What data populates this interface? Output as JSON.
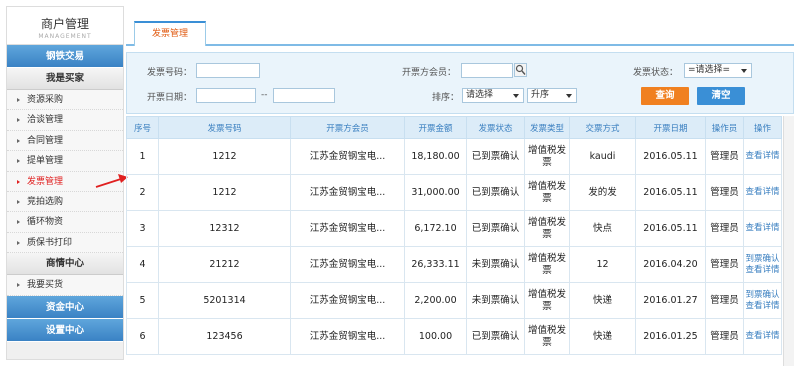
{
  "brand": {
    "title": "商户管理",
    "subtitle": "MANAGEMENT"
  },
  "sidebar": {
    "sections": [
      {
        "label": "钢铁交易",
        "style": "blue"
      },
      {
        "label": "我是买家",
        "style": "gray"
      }
    ],
    "buyer_items": [
      {
        "label": "资源采购"
      },
      {
        "label": "洽谈管理"
      },
      {
        "label": "合同管理"
      },
      {
        "label": "提单管理"
      },
      {
        "label": "发票管理",
        "active": true
      },
      {
        "label": "竞拍选购"
      },
      {
        "label": "循环物资"
      },
      {
        "label": "质保书打印"
      }
    ],
    "market_section": "商情中心",
    "market_items": [
      {
        "label": "我要买货"
      }
    ],
    "bottom_sections": [
      {
        "label": "资金中心"
      },
      {
        "label": "设置中心"
      }
    ]
  },
  "tab": {
    "label": "发票管理"
  },
  "filters": {
    "invoice_no_label": "发票号码：",
    "member_label": "开票方会员：",
    "status_label": "发票状态：",
    "status_value": "=请选择=",
    "date_label": "开票日期：",
    "date_sep": "--",
    "sort_label": "排序：",
    "sort_value": "请选择",
    "order_value": "升序",
    "query_button": "查询",
    "clear_button": "清空"
  },
  "table": {
    "headers": [
      "序号",
      "发票号码",
      "开票方会员",
      "开票金额",
      "发票状态",
      "发票类型",
      "交票方式",
      "开票日期",
      "操作员",
      "操作"
    ],
    "rows": [
      {
        "no": "1",
        "invoice": "1212",
        "member": "江苏金贸钢宝电...",
        "amount": "18,180.00",
        "status": "已到票确认",
        "type": "增值税发票",
        "method": "kaudi",
        "date": "2016.05.11",
        "operator": "管理员",
        "action1": "查看详情",
        "action2": ""
      },
      {
        "no": "2",
        "invoice": "1212",
        "member": "江苏金贸钢宝电...",
        "amount": "31,000.00",
        "status": "已到票确认",
        "type": "增值税发票",
        "method": "发的发",
        "date": "2016.05.11",
        "operator": "管理员",
        "action1": "查看详情",
        "action2": ""
      },
      {
        "no": "3",
        "invoice": "12312",
        "member": "江苏金贸钢宝电...",
        "amount": "6,172.10",
        "status": "已到票确认",
        "type": "增值税发票",
        "method": "快点",
        "date": "2016.05.11",
        "operator": "管理员",
        "action1": "查看详情",
        "action2": ""
      },
      {
        "no": "4",
        "invoice": "21212",
        "member": "江苏金贸钢宝电...",
        "amount": "26,333.11",
        "status": "未到票确认",
        "type": "增值税发票",
        "method": "12",
        "date": "2016.04.20",
        "operator": "管理员",
        "action1": "到票确认",
        "action2": "查看详情"
      },
      {
        "no": "5",
        "invoice": "5201314",
        "member": "江苏金贸钢宝电...",
        "amount": "2,200.00",
        "status": "未到票确认",
        "type": "增值税发票",
        "method": "快递",
        "date": "2016.01.27",
        "operator": "管理员",
        "action1": "到票确认",
        "action2": "查看详情"
      },
      {
        "no": "6",
        "invoice": "123456",
        "member": "江苏金贸钢宝电...",
        "amount": "100.00",
        "status": "已到票确认",
        "type": "增值税发票",
        "method": "快递",
        "date": "2016.01.25",
        "operator": "管理员",
        "action1": "查看详情",
        "action2": ""
      }
    ]
  },
  "colors": {
    "accent": "#3a8fd6",
    "active": "#e02020",
    "query": "#f08020"
  }
}
